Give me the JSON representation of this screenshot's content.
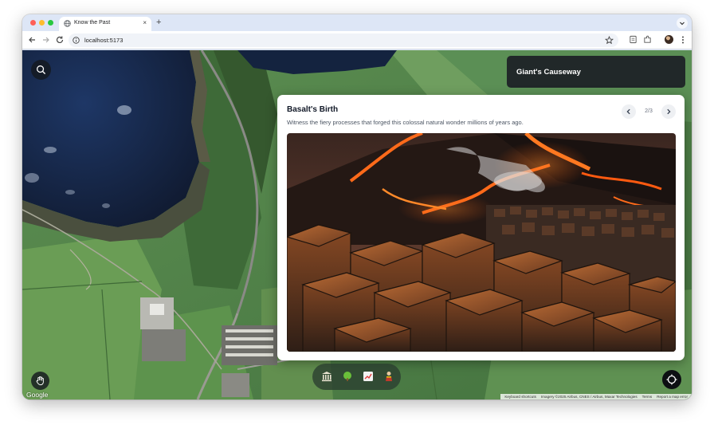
{
  "browser": {
    "tab_title": "Know the Past",
    "tab_close": "×",
    "new_tab": "+",
    "url": "localhost:5173",
    "icons": [
      "back-arrow-icon",
      "forward-arrow-icon",
      "reload-icon",
      "info-icon",
      "star-icon",
      "reading-list-icon",
      "extensions-icon",
      "profile-avatar",
      "kebab-menu-icon",
      "tab-search-chevron-icon",
      "globe-icon"
    ]
  },
  "map": {
    "place_title": "Giant's Causeway",
    "google_logo": "Google",
    "attribution": [
      "Keyboard shortcuts",
      "Imagery ©2025 Airbus, CNES / Airbus, Maxar Technologies",
      "Terms",
      "Report a map error"
    ]
  },
  "story": {
    "title": "Basalt's Birth",
    "description": "Witness the fiery processes that forged this colossal natural wonder millions of years ago.",
    "current_page": 2,
    "total_pages": 3,
    "counter": "2/3"
  },
  "dock": {
    "items": [
      {
        "name": "museum-icon",
        "glyph": "🏛"
      },
      {
        "name": "nature-icon",
        "glyph": "🌳"
      },
      {
        "name": "chart-icon",
        "glyph": "📈"
      },
      {
        "name": "story-icon",
        "glyph": "🎎"
      }
    ]
  },
  "colors": {
    "accent_dark": "#1c2026",
    "card_bg": "#ffffff",
    "lava": "#ff6a1a",
    "map_green": "#4d7a45",
    "sea": "#14233f"
  }
}
